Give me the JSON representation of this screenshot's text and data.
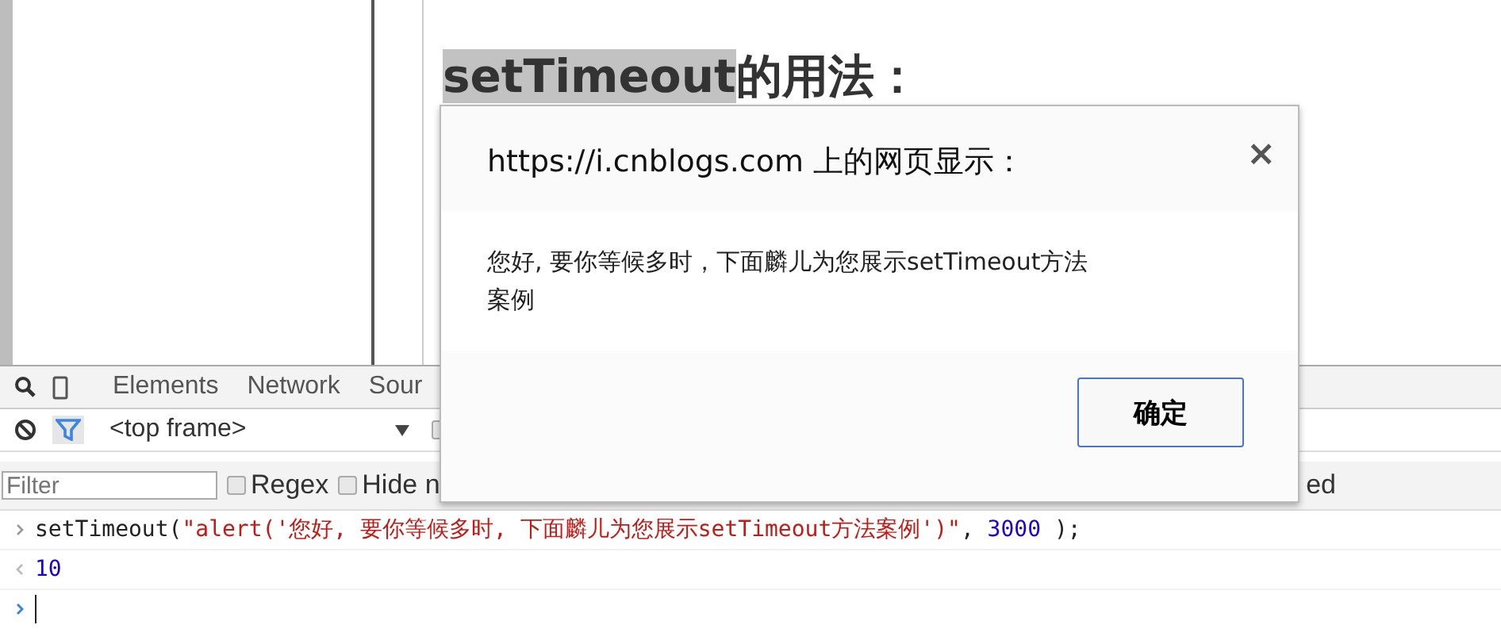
{
  "page": {
    "heading_highlight": "setTimeout",
    "heading_rest": "的用法："
  },
  "devtools": {
    "tabs": [
      {
        "label": "Elements",
        "selected": false
      },
      {
        "label": "Network",
        "selected": false
      },
      {
        "label": "Sour",
        "selected": false
      }
    ],
    "frame_select": "<top frame>",
    "frame_checkbox": {
      "checked": false
    },
    "filter": {
      "placeholder": "Filter"
    },
    "options": [
      {
        "label": "Regex",
        "checked": false
      },
      {
        "label": "Hide n",
        "checked": false
      }
    ],
    "trailing_label": "ed",
    "console": {
      "input": [
        {
          "kind": "plain",
          "text": "setTimeout("
        },
        {
          "kind": "string",
          "text": "\"alert('您好, 要你等候多时, 下面麟儿为您展示setTimeout方法案例')\""
        },
        {
          "kind": "plain",
          "text": ", "
        },
        {
          "kind": "number",
          "text": "3000"
        },
        {
          "kind": "plain",
          "text": " );"
        }
      ],
      "result": "10"
    }
  },
  "dialog": {
    "title": "https://i.cnblogs.com 上的网页显示：",
    "message": "您好, 要你等候多时，下面麟儿为您展示setTimeout方法案例",
    "close": "×",
    "button": "确定"
  }
}
